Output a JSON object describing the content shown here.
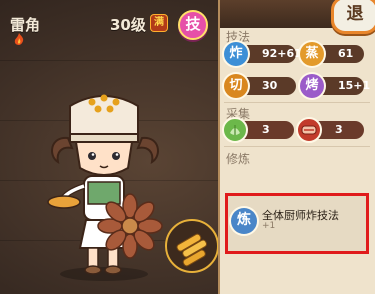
{
  "character": {
    "name": "雷角",
    "level": "30级",
    "max_badge": "满",
    "skill_button": "技",
    "element_icon": "fire-icon"
  },
  "back_button": "退",
  "skills": {
    "title": "技法",
    "items": [
      {
        "icon": "炸",
        "value": "92+61",
        "color": "#3d8fd6"
      },
      {
        "icon": "蒸",
        "value": "61",
        "color": "#e39a2b"
      },
      {
        "icon": "切",
        "value": "30",
        "color": "#d9871f"
      },
      {
        "icon": "烤",
        "value": "15+1",
        "color": "#9b5cc9"
      }
    ]
  },
  "gathering": {
    "title": "采集",
    "items": [
      {
        "icon": "vegetable-icon",
        "value": "3"
      },
      {
        "icon": "meat-icon",
        "value": "3"
      }
    ]
  },
  "training": {
    "title": "修炼",
    "icon": "炼",
    "text": "全体厨师炸技法",
    "sub": "+1"
  }
}
